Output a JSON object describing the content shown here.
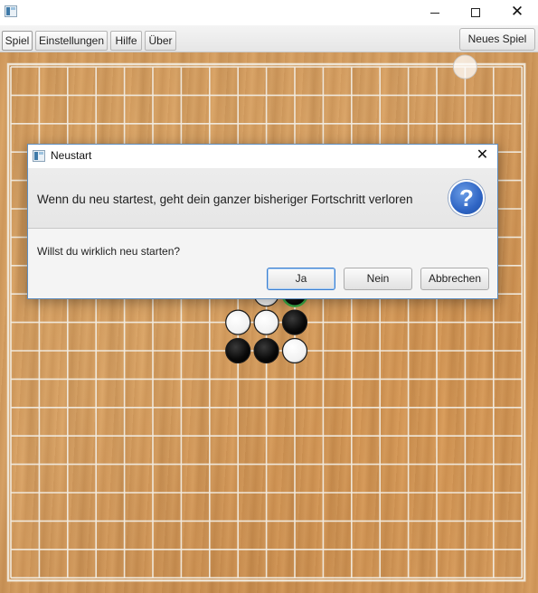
{
  "window": {
    "minimize_glyph": "",
    "maximize_glyph": "",
    "close_glyph": "✕"
  },
  "menu": {
    "items": [
      {
        "label": "Spiel"
      },
      {
        "label": "Einstellungen"
      },
      {
        "label": "Hilfe"
      },
      {
        "label": "Über"
      }
    ],
    "new_game_label": "Neues Spiel"
  },
  "board": {
    "grid_lines": 19,
    "stones": [
      {
        "col": 9,
        "row": 8,
        "color": "white",
        "partial": true
      },
      {
        "col": 10,
        "row": 8,
        "color": "black",
        "partial": true,
        "ring": "#3aa845"
      },
      {
        "col": 8,
        "row": 9,
        "color": "white"
      },
      {
        "col": 9,
        "row": 9,
        "color": "white"
      },
      {
        "col": 10,
        "row": 9,
        "color": "black"
      },
      {
        "col": 8,
        "row": 10,
        "color": "black"
      },
      {
        "col": 9,
        "row": 10,
        "color": "black"
      },
      {
        "col": 10,
        "row": 10,
        "color": "white"
      }
    ],
    "hover_marker": {
      "col": 16,
      "row": 0
    },
    "colors": {
      "line": "#f2ece1",
      "white_stone": "#ffffff",
      "black_stone": "#0a0a0a"
    }
  },
  "dialog": {
    "title": "Neustart",
    "close_glyph": "✕",
    "header": "Wenn du neu startest, geht dein ganzer bisheriger Fortschritt verloren",
    "question_icon_glyph": "?",
    "content": "Willst du wirklich neu starten?",
    "buttons": {
      "yes": "Ja",
      "no": "Nein",
      "cancel": "Abbrechen"
    }
  }
}
